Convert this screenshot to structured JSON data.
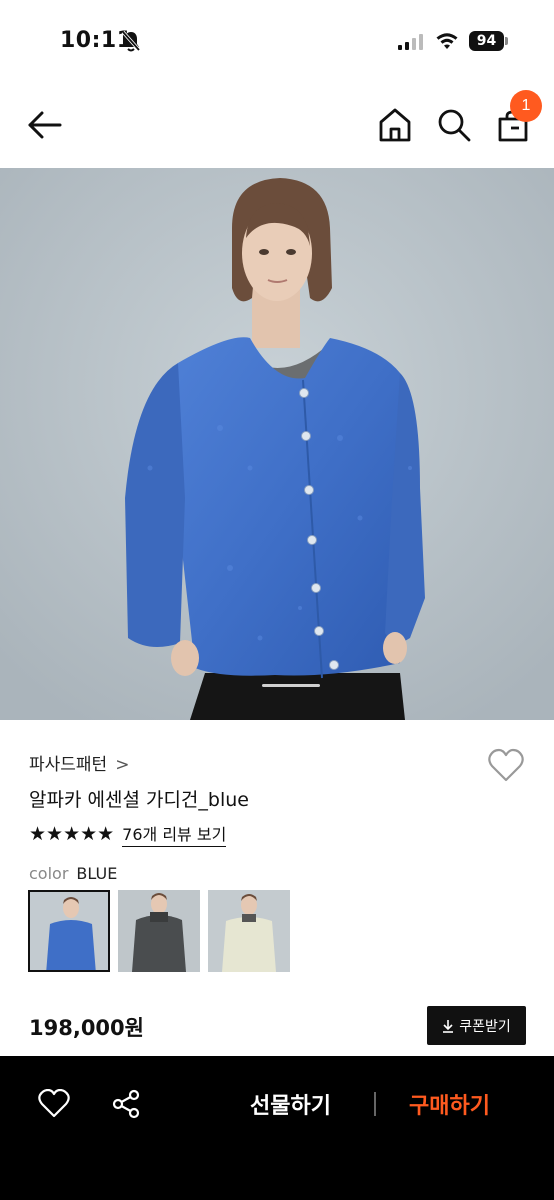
{
  "status": {
    "time": "10:11",
    "battery": "94"
  },
  "header": {
    "cart_count": "1"
  },
  "product": {
    "brand": "파사드패턴",
    "brand_chevron": ">",
    "title": "알파카 에센셜 가디건_blue",
    "stars": "★★★★★",
    "rating": 5,
    "review_link": "76개 리뷰 보기",
    "color_label": "color",
    "color_value": "BLUE",
    "color_options": [
      {
        "name": "blue",
        "hex": "#3f6fc7",
        "selected": true
      },
      {
        "name": "charcoal",
        "hex": "#4a4d4f",
        "selected": false
      },
      {
        "name": "ivory",
        "hex": "#e6e6d2",
        "selected": false
      }
    ],
    "price": "198,000원",
    "coupon_label": "쿠폰받기"
  },
  "bottom_bar": {
    "gift_label": "선물하기",
    "buy_label": "구매하기"
  },
  "colors": {
    "accent": "#ff5a1f",
    "bar_bg": "#000000",
    "sweater_blue": "#3f6fc7"
  },
  "icons": [
    "bell-off-icon",
    "signal-icon",
    "wifi-icon",
    "back-arrow-icon",
    "home-icon",
    "search-icon",
    "shopping-bag-icon",
    "heart-icon",
    "share-icon",
    "download-icon"
  ]
}
